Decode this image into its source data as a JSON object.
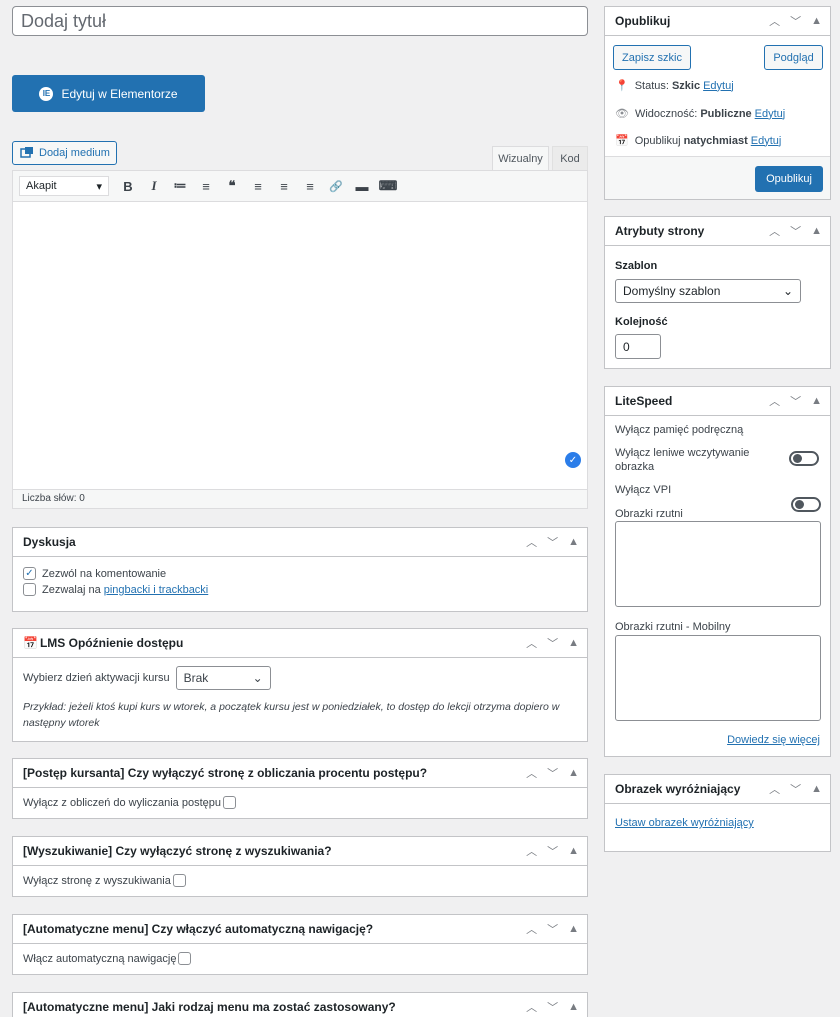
{
  "title": {
    "placeholder": "Dodaj tytuł"
  },
  "elementor": {
    "label": "Edytuj w Elementorze",
    "icon": "IE"
  },
  "media": {
    "label": "Dodaj medium"
  },
  "editor_tabs": {
    "visual": "Wizualny",
    "code": "Kod"
  },
  "toolbar": {
    "format": "Akapit",
    "icons": [
      "B",
      "I",
      "≔",
      "≡",
      "❝",
      "≡",
      "≡",
      "≡",
      "🔗",
      "▬",
      "⌨"
    ]
  },
  "word_count": "Liczba słów: 0",
  "discussion": {
    "title": "Dyskusja",
    "allow_comments": "Zezwól na komentowanie",
    "pingbacks_prefix": "Zezwalaj na",
    "pingbacks_link": "pingbacki i trackbacki"
  },
  "lms": {
    "title": "LMS Opóźnienie dostępu",
    "label": "Wybierz dzień aktywacji kursu",
    "select": "Brak",
    "note": "Przykład: jeżeli ktoś kupi kurs w wtorek, a początek kursu jest w poniedziałek, to dostęp do lekcji otrzyma dopiero w następny wtorek"
  },
  "progress": {
    "title": "[Postęp kursanta] Czy wyłączyć stronę z obliczania procentu postępu?",
    "label": "Wyłącz z obliczeń do wyliczania postępu"
  },
  "search": {
    "title": "[Wyszukiwanie] Czy wyłączyć stronę z wyszukiwania?",
    "label": "Wyłącz stronę z wyszukiwania"
  },
  "automenu": {
    "title": "[Automatyczne menu] Czy włączyć automatyczną nawigację?",
    "label": "Włącz automatyczną nawigację"
  },
  "menutype": {
    "title": "[Automatyczne menu] Jaki rodzaj menu ma zostać zastosowany?"
  },
  "publish": {
    "title": "Opublikuj",
    "save_draft": "Zapisz szkic",
    "preview": "Podgląd",
    "status_label": "Status:",
    "status_value": "Szkic",
    "visibility_label": "Widoczność:",
    "visibility_value": "Publiczne",
    "schedule_label": "Opublikuj",
    "schedule_value": "natychmiast",
    "edit": "Edytuj",
    "publish_button": "Opublikuj"
  },
  "attributes": {
    "title": "Atrybuty strony",
    "template_label": "Szablon",
    "template_value": "Domyślny szablon",
    "order_label": "Kolejność",
    "order_value": "0"
  },
  "litespeed": {
    "title": "LiteSpeed",
    "cache": "Wyłącz pamięć podręczną",
    "lazy": "Wyłącz leniwe wczytywanie obrazka",
    "vpi": "Wyłącz VPI",
    "viewport": "Obrazki rzutni",
    "viewport_mobile": "Obrazki rzutni - Mobilny",
    "learn_more": "Dowiedz się więcej"
  },
  "featured": {
    "title": "Obrazek wyróżniający",
    "set": "Ustaw obrazek wyróżniający"
  }
}
